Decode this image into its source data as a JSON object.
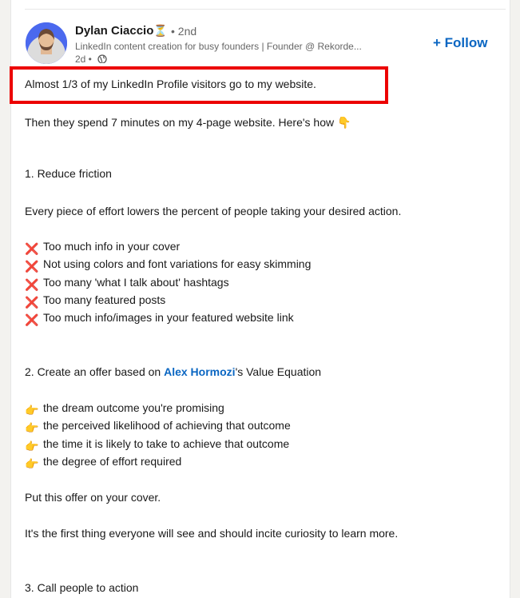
{
  "author": {
    "name": "Dylan Ciaccio",
    "hourglass_glyph": "⏳",
    "degree": "• 2nd",
    "headline": "LinkedIn content creation for busy founders | Founder @ Rekorde...",
    "time": "2d •",
    "avatar_icon": "person-avatar",
    "visibility_icon": "globe-icon"
  },
  "follow_button": {
    "label": "+ Follow",
    "color": "#0a66c2"
  },
  "highlight_color": "#ec0000",
  "post": {
    "line1": "Almost 1/3 of my LinkedIn Profile visitors go to my website.",
    "line2": "Then they spend 7 minutes on my 4-page website. Here's how",
    "line2_emoji": "👇",
    "section1_title": "1. Reduce friction",
    "section1_intro": "Every piece of effort lowers the percent of people taking your desired action.",
    "cross_glyph": "❌",
    "cross_items": [
      "Too much info in your cover",
      "Not using colors and font variations for easy skimming",
      "Too many 'what I talk about' hashtags",
      "Too many featured posts",
      "Too much info/images in your featured website link"
    ],
    "section2_prefix": "2. Create an offer based on",
    "section2_link": "Alex Hormozi",
    "section2_suffix": "'s Value Equation",
    "point_glyph": "👉",
    "point_items": [
      "the dream outcome you're promising",
      "the perceived likelihood of achieving that outcome",
      "the time it is likely to take to achieve that outcome",
      "the degree of effort required"
    ],
    "offer_line": "Put this offer on your cover.",
    "curiosity_line": "It's the first thing everyone will see and should incite curiosity to learn more.",
    "section3_title": "3. Call people to action"
  }
}
